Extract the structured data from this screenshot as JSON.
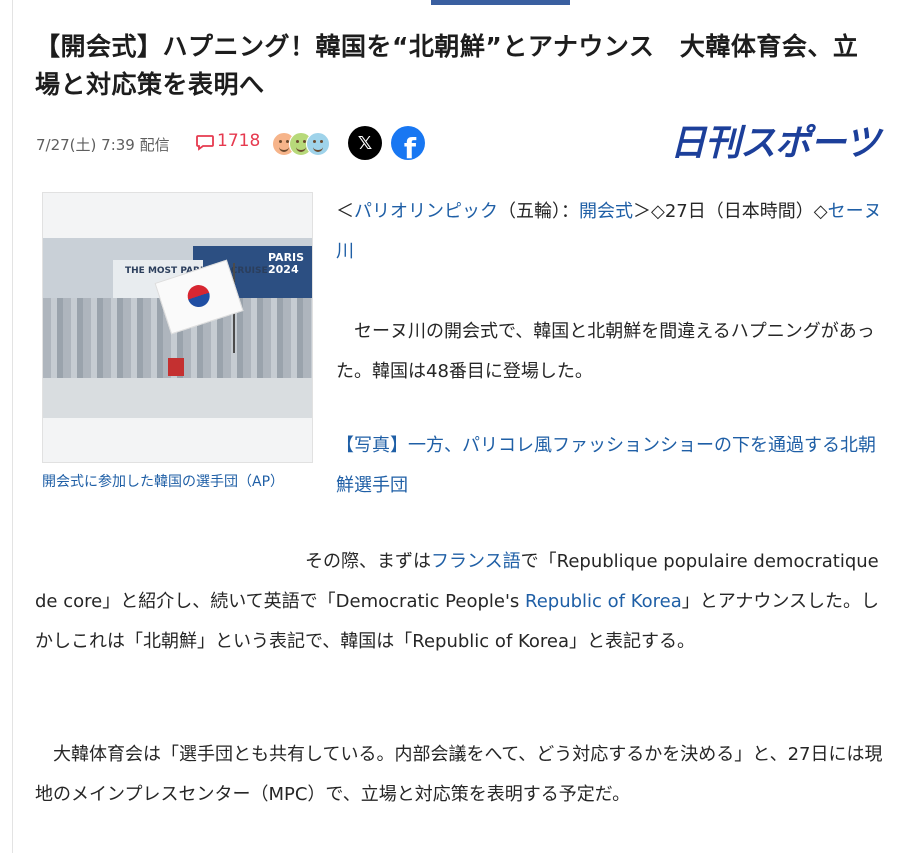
{
  "article": {
    "headline": "【開会式】ハプニング！韓国を“北朝鮮”とアナウンス　大韓体育会、立場と対応策を表明へ",
    "pubdate": "7/27(土) 7:39 配信",
    "comment_count": "1718",
    "brand_logo": "日刊スポーツ",
    "share": {
      "x_glyph": "𝕏",
      "facebook_glyph": "f"
    },
    "photo": {
      "caption": "開会式に参加した韓国の選手団（AP）",
      "sign_text": "THE MOST PARISIAN CRUISE",
      "banner_text": "PARIS 2024"
    },
    "lead": {
      "open": "＜",
      "link1": "パリオリンピック",
      "mid1": "（五輪）：",
      "link2": "開会式",
      "mid2": "＞◇27日（日本時間）◇",
      "link3": "セーヌ川"
    },
    "paragraph1": "　セーヌ川の開会式で、韓国と北朝鮮を間違えるハプニングがあった。韓国は48番目に登場した。",
    "photo_link": "【写真】一方、パリコレ風ファッションショーの下を通過する北朝鮮選手団",
    "paragraph2": {
      "indent": "　　　　　　　　　　　　　　　その際、まずは",
      "link_french": "フランス語",
      "text_a": "で「Republique populaire democratique de core」と紹介し、続いて英語で「Democratic People's ",
      "link_rok": "Republic of Korea",
      "text_b": "」とアナウンスした。しかしこれは「北朝鮮」という表記で、韓国は「Republic of Korea」と表記する。"
    },
    "paragraph3": "　大韓体育会は「選手団とも共有している。内部会議をへて、どう対応するかを決める」と、27日には現地のメインプレスセンター（MPC）で、立場と対応策を表明する予定だ。"
  },
  "reactions": [
    {
      "name": "smile-face-orange",
      "color": "#f6b48a"
    },
    {
      "name": "smile-face-green",
      "color": "#b7d97a"
    },
    {
      "name": "smile-face-blue",
      "color": "#9fd3ea"
    }
  ],
  "colors": {
    "link": "#1f5fa6",
    "comment": "#e63a4f",
    "brand": "#1c3f9a",
    "tab_indicator": "#3a5fa0"
  }
}
